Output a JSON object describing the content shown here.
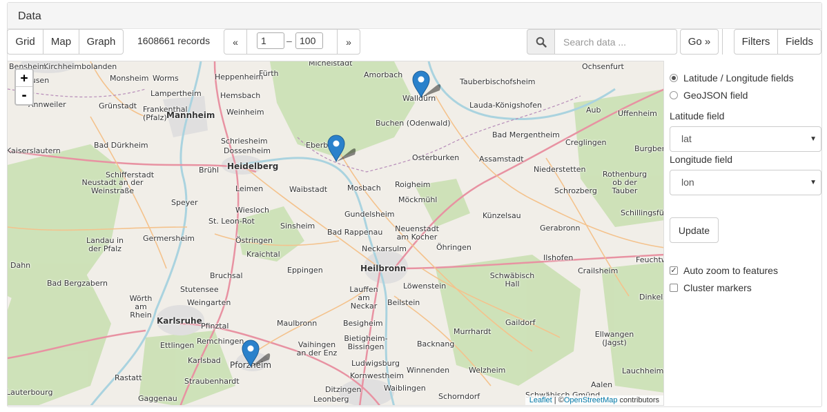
{
  "panel": {
    "title": "Data"
  },
  "toolbar": {
    "views": [
      "Grid",
      "Map",
      "Graph"
    ],
    "records": "1608661 records",
    "pager": {
      "prev": "«",
      "from": "1",
      "separator": "–",
      "to": "100",
      "next": "»"
    },
    "search": {
      "placeholder": "Search data ...",
      "go_label": "Go »"
    },
    "filters_label": "Filters",
    "fields_label": "Fields"
  },
  "map": {
    "zoom_in": "+",
    "zoom_out": "-",
    "attribution": {
      "leaflet": "Leaflet",
      "separator": " | ©",
      "osm": "OpenStreetMap",
      "suffix": " contributors"
    },
    "places": [
      "Kirchheimbolanden",
      "Monsheim",
      "Worms",
      "Heppenheim",
      "Fürth",
      "Michelstadt",
      "Amorbach",
      "Ochsenfurt",
      "Tauberbischofsheim",
      "Walldürn",
      "Lauda-Königshofen",
      "Aub",
      "Uffenheim",
      "Lampertheim",
      "Hemsbach",
      "Grünstadt",
      "Frankenthal (Pfalz)",
      "Weinheim",
      "Buchen (Odenwald)",
      "Bad Mergentheim",
      "Creglingen",
      "Burgberr",
      "Mannheim",
      "Schriesheim",
      "Dossenheim",
      "Eberbach",
      "Bad Dürkheim",
      "Heidelberg",
      "Osterburken",
      "Assamstadt",
      "Niederstetten",
      "Rothenburg ob der Tauber",
      "Schifferstadt",
      "Brühl",
      "Neustadt an der Weinstraße",
      "Leimen",
      "Mosbach",
      "Roigheim",
      "Schrozberg",
      "Speyer",
      "Wiesloch",
      "Waibstadt",
      "Möckmühl",
      "Gundelsheim",
      "Schillingsfürst",
      "St. Leon-Rot",
      "Sinsheim",
      "Bad Rappenau",
      "Neuenstadt am Kocher",
      "Künzelsau",
      "Gerabronn",
      "Landau in der Pfalz",
      "Germersheim",
      "Östringen",
      "Neckarsulm",
      "Öhringen",
      "Feuchtw",
      "Dahn",
      "Kraichtal",
      "Heilbronn",
      "Ilshofen",
      "Crailsheim",
      "Bruchsal",
      "Eppingen",
      "Bad Bergzabern",
      "Stutensee",
      "Lauffen am Neckar",
      "Löwenstein",
      "Schwäbisch Hall",
      "Dinkelsb",
      "Wörth am Rhein",
      "Weingarten",
      "Beilstein",
      "Karlsruhe",
      "Pfinztal",
      "Maulbronn",
      "Besigheim",
      "Gaildorf",
      "Murrhardt",
      "Ettlingen",
      "Remchingen",
      "Bietigheim-Bissingen",
      "Backnang",
      "Ellwangen (Jagst)",
      "Karlsbad",
      "Pforzheim",
      "Vaihingen an der Enz",
      "Ludwigsburg",
      "Winnenden",
      "Welzheim",
      "Lauchheim",
      "Rastatt",
      "Straubenhardt",
      "Kornwestheim",
      "Aalen",
      "Ditzingen",
      "Waiblingen",
      "Lauterbourg",
      "Gaggenau",
      "Leonberg",
      "Schorndorf",
      "Schwäbisch Gmünd",
      "Kaiserslautern",
      "Bensheim",
      "Sausen",
      "Annweiler"
    ]
  },
  "sidebar": {
    "radio_latlon": "Latitude / Longitude fields",
    "radio_geojson": "GeoJSON field",
    "lat_label": "Latitude field",
    "lat_value": "lat",
    "lon_label": "Longitude field",
    "lon_value": "lon",
    "update_label": "Update",
    "auto_zoom": "Auto zoom to features",
    "cluster": "Cluster markers"
  },
  "colors": {
    "marker": "#2a81cb",
    "motorway": "#e892a2",
    "primary": "#fcd6a4",
    "forest": "#c8dfb0"
  }
}
